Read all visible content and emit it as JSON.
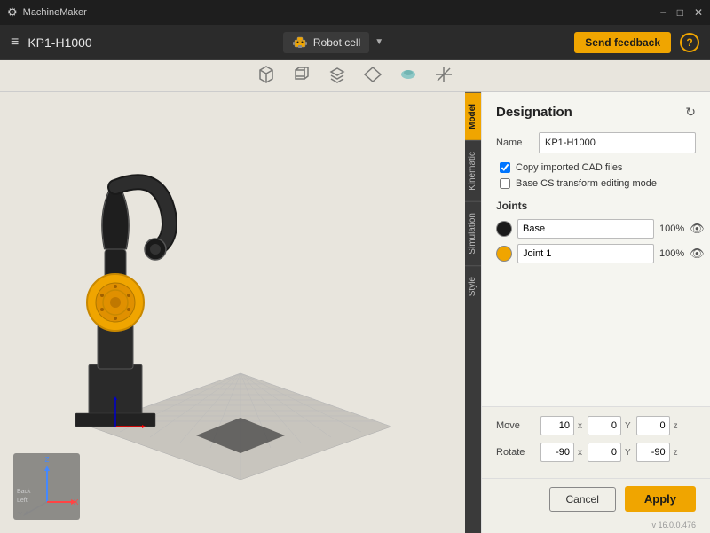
{
  "titlebar": {
    "app_name": "MachineMaker",
    "btn_minimize": "−",
    "btn_restore": "□",
    "btn_close": "✕"
  },
  "topbar": {
    "menu_icon": "≡",
    "title": "KP1-H1000",
    "robot_cell_label": "Robot cell",
    "feedback_label": "Send feedback",
    "help_label": "?"
  },
  "toolbar": {
    "icons": [
      "cube",
      "box",
      "layers",
      "shape",
      "teal-shape",
      "cross"
    ]
  },
  "side_tabs": [
    {
      "id": "model",
      "label": "Model",
      "active": true
    },
    {
      "id": "kinematic",
      "label": "Kinematic",
      "active": false
    },
    {
      "id": "simulation",
      "label": "Simulation",
      "active": false
    },
    {
      "id": "style",
      "label": "Style",
      "active": false
    }
  ],
  "panel": {
    "title": "Designation",
    "name_label": "Name",
    "name_value": "KP1-H1000",
    "checkbox1_label": "Copy imported CAD files",
    "checkbox1_checked": true,
    "checkbox2_label": "Base CS transform editing mode",
    "checkbox2_checked": false,
    "joints_title": "Joints",
    "joints": [
      {
        "id": "base",
        "color": "#1a1a1a",
        "name": "Base",
        "pct": "100%",
        "visible": true
      },
      {
        "id": "joint1",
        "color": "#f0a500",
        "name": "Joint 1",
        "pct": "100%",
        "visible": true
      }
    ]
  },
  "bottom": {
    "move_label": "Move",
    "move_x": "10",
    "move_y": "0",
    "move_z": "0",
    "rotate_label": "Rotate",
    "rotate_x": "-90",
    "rotate_y": "0",
    "rotate_z": "-90"
  },
  "footer": {
    "cancel_label": "Cancel",
    "apply_label": "Apply"
  },
  "version": "v 16.0.0.476"
}
